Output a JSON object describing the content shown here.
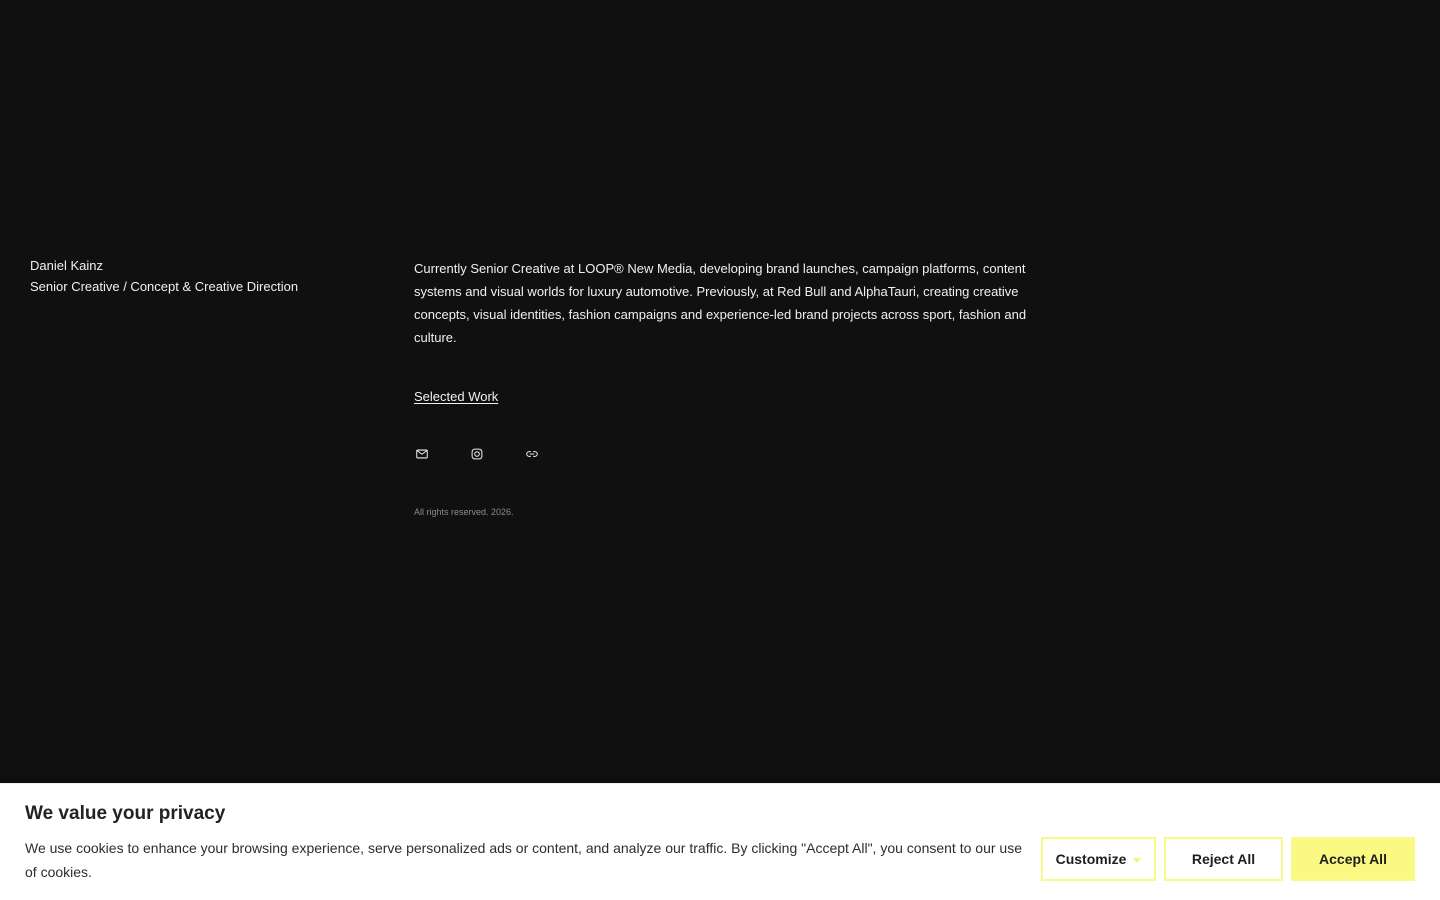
{
  "identity": {
    "name": "Daniel Kainz",
    "role": "Senior Creative / Concept & Creative Direction"
  },
  "bio": "Currently Senior Creative at LOOP® New Media, developing brand launches, campaign platforms, content systems and visual worlds for luxury automotive. Previously, at Red Bull and AlphaTauri, creating creative concepts, visual identities, fashion campaigns and experience-led brand projects across sport, fashion and culture.",
  "links": {
    "selected_work": "Selected Work"
  },
  "social": [
    {
      "icon": "mail-icon"
    },
    {
      "icon": "instagram-icon"
    },
    {
      "icon": "link-icon"
    }
  ],
  "footer": {
    "copyright": "All rights reserved. 2026."
  },
  "cookie_banner": {
    "title": "We value your privacy",
    "text": "We use cookies to enhance your browsing experience, serve personalized ads or content, and analyze our traffic. By clicking \"Accept All\", you consent to our use of cookies.",
    "buttons": {
      "customize": "Customize",
      "reject": "Reject All",
      "accept": "Accept All"
    }
  },
  "colors": {
    "background": "#101010",
    "text": "#f0f0f0",
    "muted": "#8b8b8b",
    "banner_background": "#ffffff",
    "accent": "#fafa82"
  }
}
